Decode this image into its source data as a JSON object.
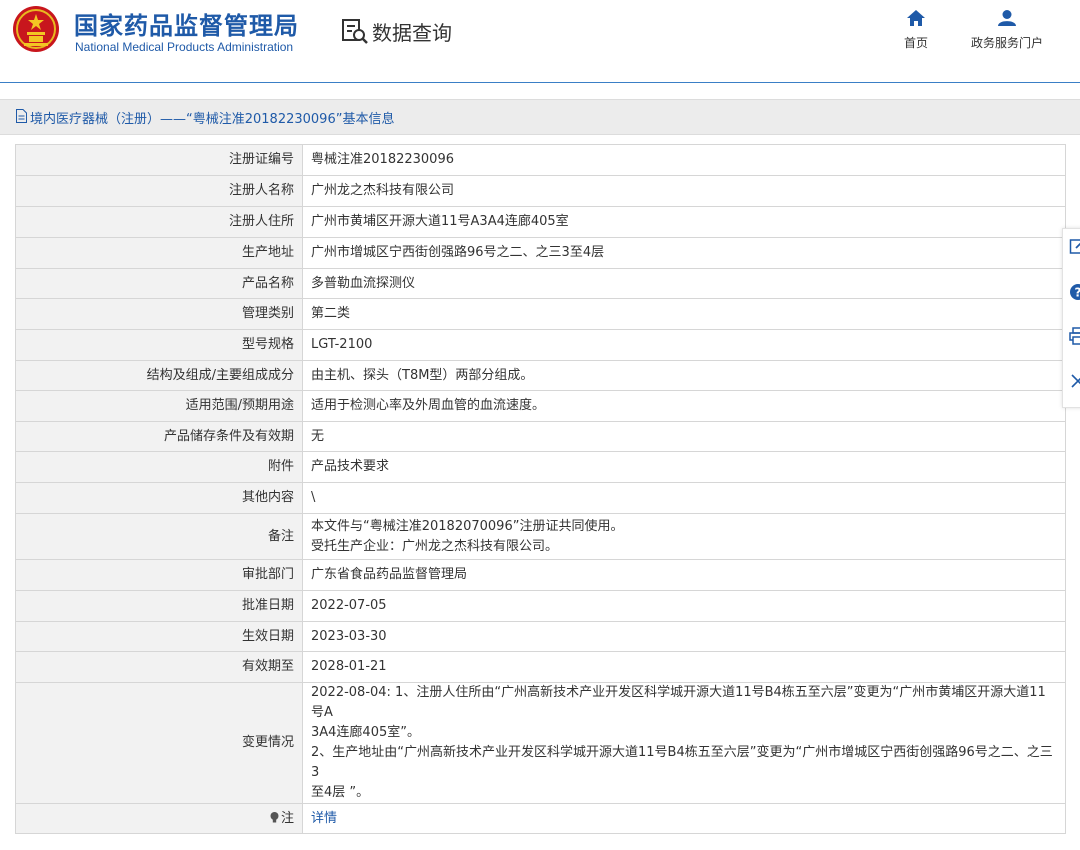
{
  "header": {
    "logo_cn": "国家药品监督管理局",
    "logo_en": "National Medical Products Administration",
    "query_title": "数据查询",
    "nav": [
      {
        "label": "首页",
        "icon": "home-icon"
      },
      {
        "label": "政务服务门户",
        "icon": "user-icon"
      }
    ]
  },
  "title_bar": {
    "text": "境内医疗器械（注册）——“粤械注准20182230096”基本信息",
    "icon": "document-icon"
  },
  "rows": [
    {
      "label": "注册证编号",
      "value": [
        "粤械注准20182230096"
      ]
    },
    {
      "label": "注册人名称",
      "value": [
        "广州龙之杰科技有限公司"
      ]
    },
    {
      "label": "注册人住所",
      "value": [
        "广州市黄埔区开源大道11号A3A4连廊405室"
      ]
    },
    {
      "label": "生产地址",
      "value": [
        "广州市增城区宁西街创强路96号之二、之三3至4层"
      ]
    },
    {
      "label": "产品名称",
      "value": [
        "多普勒血流探测仪"
      ]
    },
    {
      "label": "管理类别",
      "value": [
        "第二类"
      ]
    },
    {
      "label": "型号规格",
      "value": [
        "LGT-2100"
      ]
    },
    {
      "label": "结构及组成/主要组成成分",
      "value": [
        "由主机、探头（T8M型）两部分组成。"
      ]
    },
    {
      "label": "适用范围/预期用途",
      "value": [
        "适用于检测心率及外周血管的血流速度。"
      ]
    },
    {
      "label": "产品储存条件及有效期",
      "value": [
        "无"
      ]
    },
    {
      "label": "附件",
      "value": [
        "产品技术要求"
      ]
    },
    {
      "label": "其他内容",
      "value": [
        "\\"
      ]
    },
    {
      "label": "备注",
      "value": [
        "本文件与“粤械注准20182070096”注册证共同使用。",
        "受托生产企业：广州龙之杰科技有限公司。"
      ]
    },
    {
      "label": "审批部门",
      "value": [
        "广东省食品药品监督管理局"
      ]
    },
    {
      "label": "批准日期",
      "value": [
        "2022-07-05"
      ]
    },
    {
      "label": "生效日期",
      "value": [
        "2023-03-30"
      ]
    },
    {
      "label": "有效期至",
      "value": [
        "2028-01-21"
      ]
    },
    {
      "label": "变更情况",
      "value": [
        "2022-08-04: 1、注册人住所由“广州高新技术产业开发区科学城开源大道11号B4栋五至六层”变更为“广州市黄埔区开源大道11号A",
        "3A4连廊405室”。",
        "2、生产地址由“广州高新技术产业开发区科学城开源大道11号B4栋五至六层”变更为“广州市增城区宁西街创强路96号之二、之三3",
        "至4层 ”。"
      ]
    }
  ],
  "note_row": {
    "label": "注",
    "link": "详情",
    "icon": "bulb-icon"
  },
  "side_toolbar": [
    {
      "icon": "edit-icon"
    },
    {
      "icon": "help-icon"
    },
    {
      "icon": "print-icon"
    },
    {
      "icon": "close-icon"
    }
  ],
  "colors": {
    "brand": "#1f5aa8",
    "label_bg": "#f2f2f2",
    "border": "#d6d6d6",
    "title_bg": "#ececec"
  }
}
